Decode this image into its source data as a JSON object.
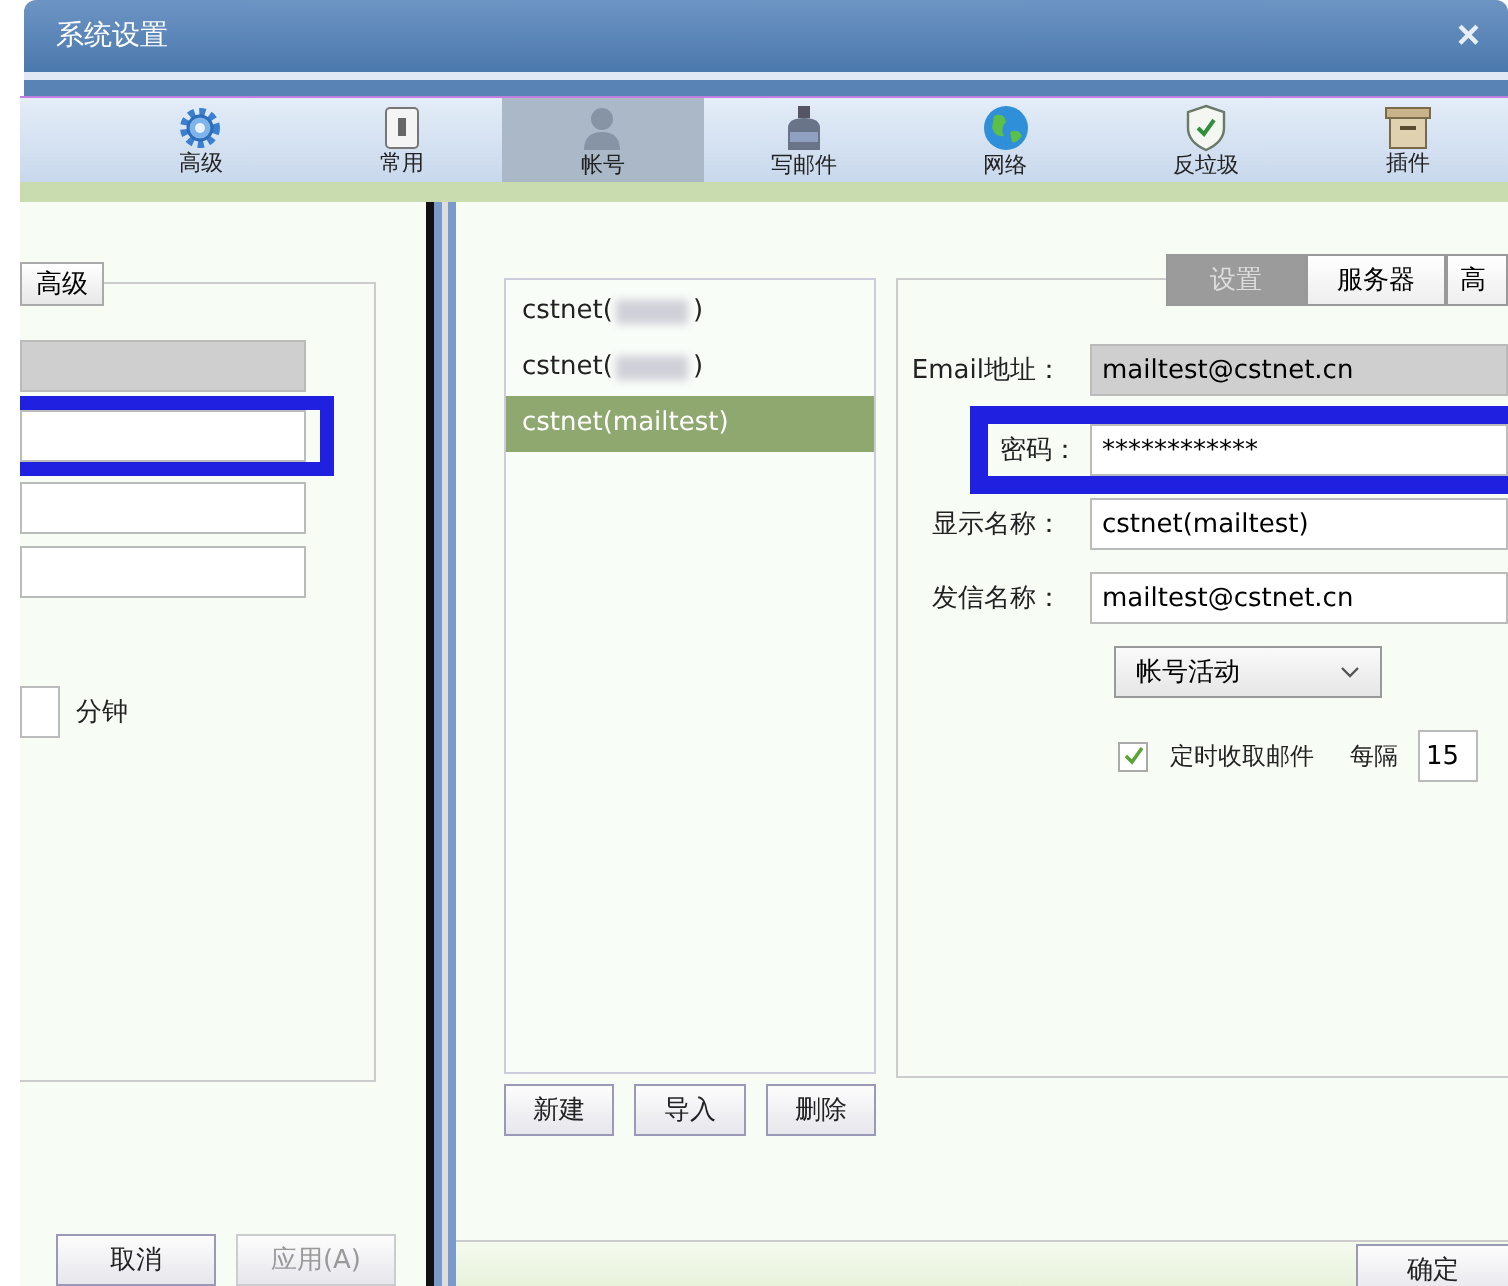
{
  "window": {
    "title": "系统设置",
    "close": "×"
  },
  "toolbar": [
    {
      "label": "高级",
      "selected": false
    },
    {
      "label": "常用",
      "selected": false
    },
    {
      "label": "帐号",
      "selected": true
    },
    {
      "label": "写邮件",
      "selected": false
    },
    {
      "label": "网络",
      "selected": false
    },
    {
      "label": "反垃圾",
      "selected": false
    },
    {
      "label": "插件",
      "selected": false
    }
  ],
  "left_panel": {
    "tab": "高级",
    "fields": [
      {
        "disabled": true,
        "highlighted": false
      },
      {
        "disabled": false,
        "highlighted": true
      },
      {
        "disabled": false,
        "highlighted": false
      },
      {
        "disabled": false,
        "highlighted": false
      }
    ],
    "unit": "分钟",
    "buttons": [
      {
        "label": "取消",
        "disabled": false
      },
      {
        "label": "应用(A)",
        "disabled": true
      }
    ]
  },
  "accounts": [
    {
      "label": "cstnet(",
      "redacted": true,
      "closing": ")",
      "selected": false
    },
    {
      "label": "cstnet(",
      "redacted": true,
      "closing": ")",
      "selected": false
    },
    {
      "label": "cstnet(mailtest)",
      "redacted": false,
      "selected": true
    }
  ],
  "account_buttons": [
    "新建",
    "导入",
    "删除"
  ],
  "settings_tabs": [
    {
      "label": "设置",
      "selected": true
    },
    {
      "label": "服务器",
      "selected": false
    },
    {
      "label": "高",
      "selected": false
    }
  ],
  "form": [
    {
      "label": "Email地址：",
      "value": "mailtest@cstnet.cn",
      "disabled": true,
      "highlighted": false
    },
    {
      "label": "密码：",
      "value": "************",
      "disabled": false,
      "highlighted": true
    },
    {
      "label": "显示名称：",
      "value": "cstnet(mailtest)",
      "disabled": false,
      "highlighted": false
    },
    {
      "label": "发信名称：",
      "value": "mailtest@cstnet.cn",
      "disabled": false,
      "highlighted": false
    }
  ],
  "status_select": "帐号活动",
  "auto_fetch": {
    "label": "定时收取邮件",
    "checked": true,
    "interval_label": "每隔",
    "interval": "15"
  },
  "ok_button": "确定"
}
